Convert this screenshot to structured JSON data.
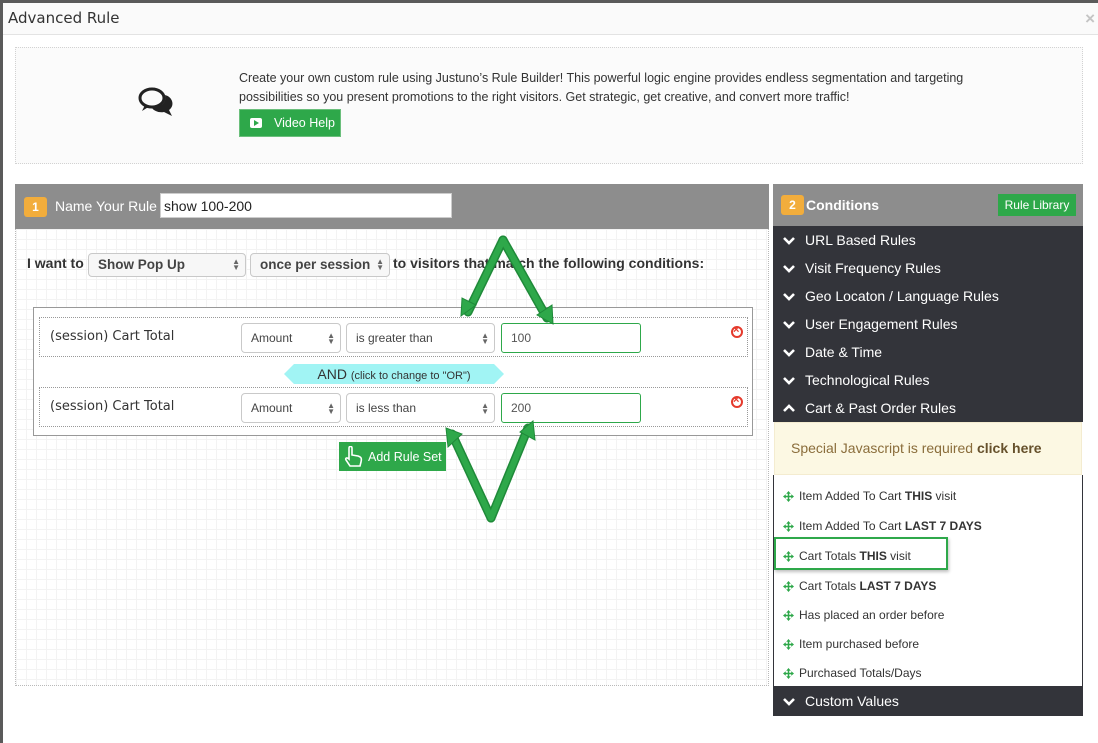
{
  "window": {
    "title": "Advanced Rule",
    "close_glyph": "×"
  },
  "intro": {
    "text": "Create your own custom rule using Justuno’s Rule Builder!    This powerful logic engine provides endless segmentation and targeting possibilities so you present promotions to the right visitors. Get strategic, get creative, and convert more traffic!",
    "icon": "chat-bubbles-icon",
    "video_button": {
      "label": "Video Help",
      "icon": "play-icon"
    }
  },
  "name_panel": {
    "step": "1",
    "label": "Name Your Rule",
    "rule_name_value": "show 100-200"
  },
  "sentence": {
    "prefix": "I want to",
    "action_select": "Show Pop Up",
    "frequency_select": "once per session",
    "suffix": "to visitors that match the following conditions:"
  },
  "conditions": [
    {
      "name": "(session) Cart Total",
      "measure": "Amount",
      "operator": "is greater than",
      "value": "100"
    },
    {
      "name": "(session) Cart Total",
      "measure": "Amount",
      "operator": "is less than",
      "value": "200"
    }
  ],
  "connector": {
    "label": "AND",
    "hint": "(click to change to \"OR\")"
  },
  "add_ruleset": {
    "label": "Add Rule Set",
    "icon": "pointing-hand-icon"
  },
  "conditions_panel": {
    "step": "2",
    "label": "Conditions",
    "library_button": "Rule Library",
    "categories": [
      {
        "label": "URL Based Rules",
        "icon": "chevron-down-icon"
      },
      {
        "label": "Visit Frequency Rules",
        "icon": "chevron-down-icon"
      },
      {
        "label": "Geo Locaton / Language Rules",
        "icon": "chevron-down-icon"
      },
      {
        "label": "User Engagement Rules",
        "icon": "chevron-down-icon"
      },
      {
        "label": "Date & Time",
        "icon": "chevron-down-icon"
      },
      {
        "label": "Technological Rules",
        "icon": "chevron-down-icon"
      },
      {
        "label": "Cart & Past Order Rules",
        "icon": "chevron-up-icon",
        "expanded": true
      }
    ],
    "notice": {
      "text": "Special Javascript is required",
      "link": "click here"
    },
    "rules": [
      {
        "pre": "Item Added To Cart",
        "bold": "THIS",
        "post": "visit"
      },
      {
        "pre": "Item Added To Cart",
        "bold": "LAST 7 DAYS",
        "post": ""
      },
      {
        "pre": "Cart Totals",
        "bold": "THIS",
        "post": "visit",
        "highlighted": true
      },
      {
        "pre": "Cart Totals",
        "bold": "LAST 7 DAYS",
        "post": ""
      },
      {
        "pre": "Has placed an order before",
        "bold": "",
        "post": ""
      },
      {
        "pre": "Item purchased before",
        "bold": "",
        "post": ""
      },
      {
        "pre": "Purchased Totals/Days",
        "bold": "",
        "post": ""
      }
    ],
    "footer_category": {
      "label": "Custom Values",
      "icon": "chevron-down-icon"
    }
  },
  "colors": {
    "accent_green": "#2ea84a",
    "step_badge": "#f2ad3c",
    "panel_header": "#8d8d8d",
    "category_bg": "#33343a",
    "connector_bg": "#a1f4f4",
    "delete_red": "#e53a2c",
    "notice_bg": "#fcf8e3"
  }
}
